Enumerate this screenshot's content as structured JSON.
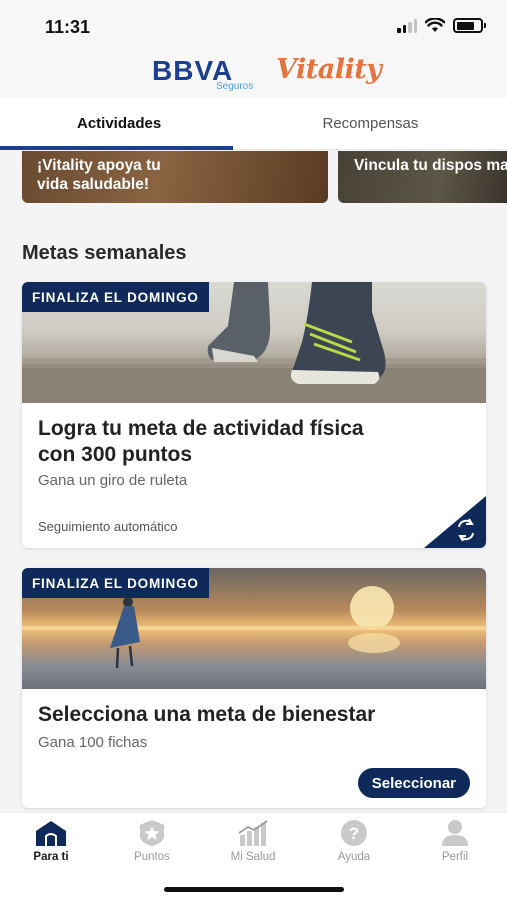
{
  "status_bar": {
    "time": "11:31"
  },
  "header": {
    "brand": "BBVA",
    "brand_sub": "Seguros",
    "partner": "Vitality"
  },
  "tabs": [
    {
      "label": "Actividades",
      "active": true
    },
    {
      "label": "Recompensas",
      "active": false
    }
  ],
  "promos": [
    {
      "text": "¡Vitality apoya tu\nvida saludable!"
    },
    {
      "text": "Vincula tu dispos\nmaximiza tus rec"
    }
  ],
  "section_title": "Metas semanales",
  "cards": [
    {
      "badge": "FINALIZA EL DOMINGO",
      "title": "Logra tu meta de actividad física con 300 puntos",
      "subtitle": "Gana un giro de ruleta",
      "tracking": "Seguimiento automático",
      "corner_icon": "sync-icon"
    },
    {
      "badge": "FINALIZA EL DOMINGO",
      "title": "Selecciona una meta de bienestar",
      "subtitle": "Gana 100 fichas",
      "button": "Seleccionar"
    }
  ],
  "bottom_nav": [
    {
      "label": "Para ti",
      "icon": "home-icon",
      "active": true
    },
    {
      "label": "Puntos",
      "icon": "points-badge-icon",
      "active": false
    },
    {
      "label": "Mi Salud",
      "icon": "health-chart-icon",
      "active": false
    },
    {
      "label": "Ayuda",
      "icon": "help-icon",
      "active": false
    },
    {
      "label": "Perfil",
      "icon": "profile-icon",
      "active": false
    }
  ],
  "colors": {
    "primary": "#0f2a5a",
    "brand_blue": "#1c3f8f",
    "vitality_orange": "#e4733d",
    "background": "#f4f4f5"
  }
}
